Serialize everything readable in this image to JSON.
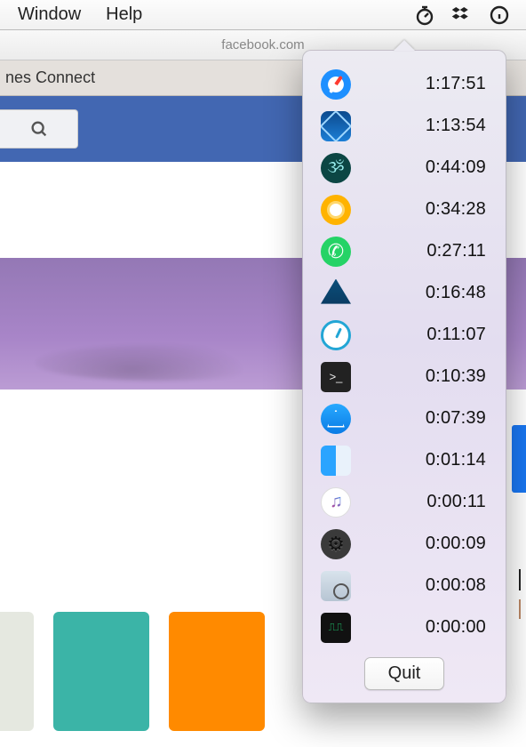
{
  "menubar": {
    "items": [
      "Window",
      "Help"
    ]
  },
  "addressbar": {
    "text": "facebook.com"
  },
  "tab": {
    "title": "nes Connect"
  },
  "popup": {
    "entries": [
      {
        "app": "safari-icon",
        "time": "1:17:51"
      },
      {
        "app": "xcode-icon",
        "time": "1:13:54"
      },
      {
        "app": "evernote-icon",
        "time": "0:44:09"
      },
      {
        "app": "chrome-icon",
        "time": "0:34:28"
      },
      {
        "app": "whatsapp-icon",
        "time": "0:27:11"
      },
      {
        "app": "affinity-icon",
        "time": "0:16:48"
      },
      {
        "app": "timer-icon",
        "time": "0:11:07"
      },
      {
        "app": "terminal-icon",
        "time": "0:10:39"
      },
      {
        "app": "appstore-icon",
        "time": "0:07:39"
      },
      {
        "app": "finder-icon",
        "time": "0:01:14"
      },
      {
        "app": "itunes-icon",
        "time": "0:00:11"
      },
      {
        "app": "settings-icon",
        "time": "0:00:09"
      },
      {
        "app": "preview-icon",
        "time": "0:00:08"
      },
      {
        "app": "activity-icon",
        "time": "0:00:00"
      }
    ],
    "quit_label": "Quit"
  }
}
